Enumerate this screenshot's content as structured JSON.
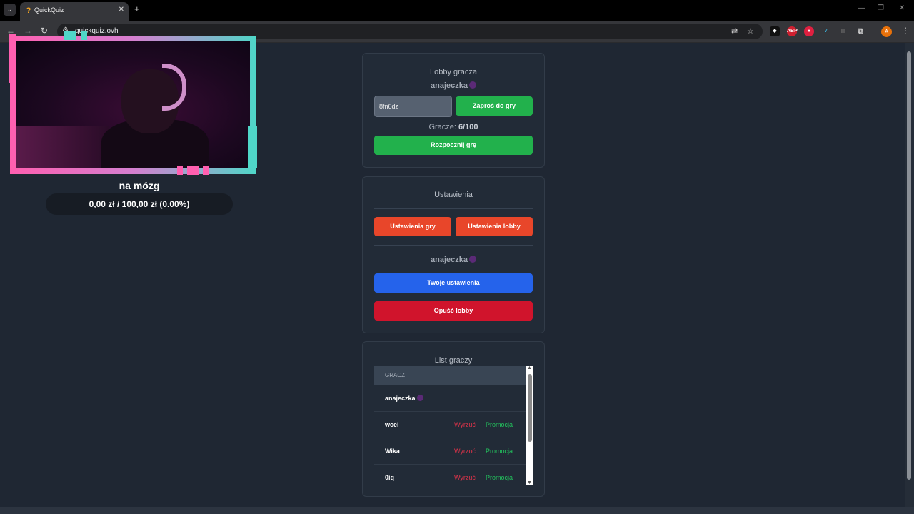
{
  "browser": {
    "tab_title": "QuickQuiz",
    "tab_favicon": "?",
    "url": "quickquiz.ovh",
    "profile_initial": "A"
  },
  "lobby": {
    "title": "Lobby gracza",
    "owner": "anajeczka",
    "code_value": "8fn6dz",
    "invite_label": "Zaproś do gry",
    "players_label": "Gracze:",
    "players_count": "6/100",
    "start_label": "Rozpocznij grę"
  },
  "settings": {
    "title": "Ustawienia",
    "game_settings_label": "Ustawienia gry",
    "lobby_settings_label": "Ustawienia lobby",
    "user": "anajeczka",
    "your_settings_label": "Twoje ustawienia",
    "leave_label": "Opuść lobby"
  },
  "players_list": {
    "title": "List graczy",
    "column_header": "GRACZ",
    "kick_label": "Wyrzuć",
    "promote_label": "Promocja",
    "rows": [
      {
        "name": "anajeczka"
      },
      {
        "name": "wcel"
      },
      {
        "name": "Wika"
      },
      {
        "name": "0iq"
      }
    ]
  },
  "overlay": {
    "stream_title": "na mózg",
    "goal": "0,00 zł / 100,00 zł (0.00%)"
  },
  "colors": {
    "green": "#22b14c",
    "orange": "#e8462a",
    "blue": "#2563eb",
    "red": "#d0142c"
  }
}
